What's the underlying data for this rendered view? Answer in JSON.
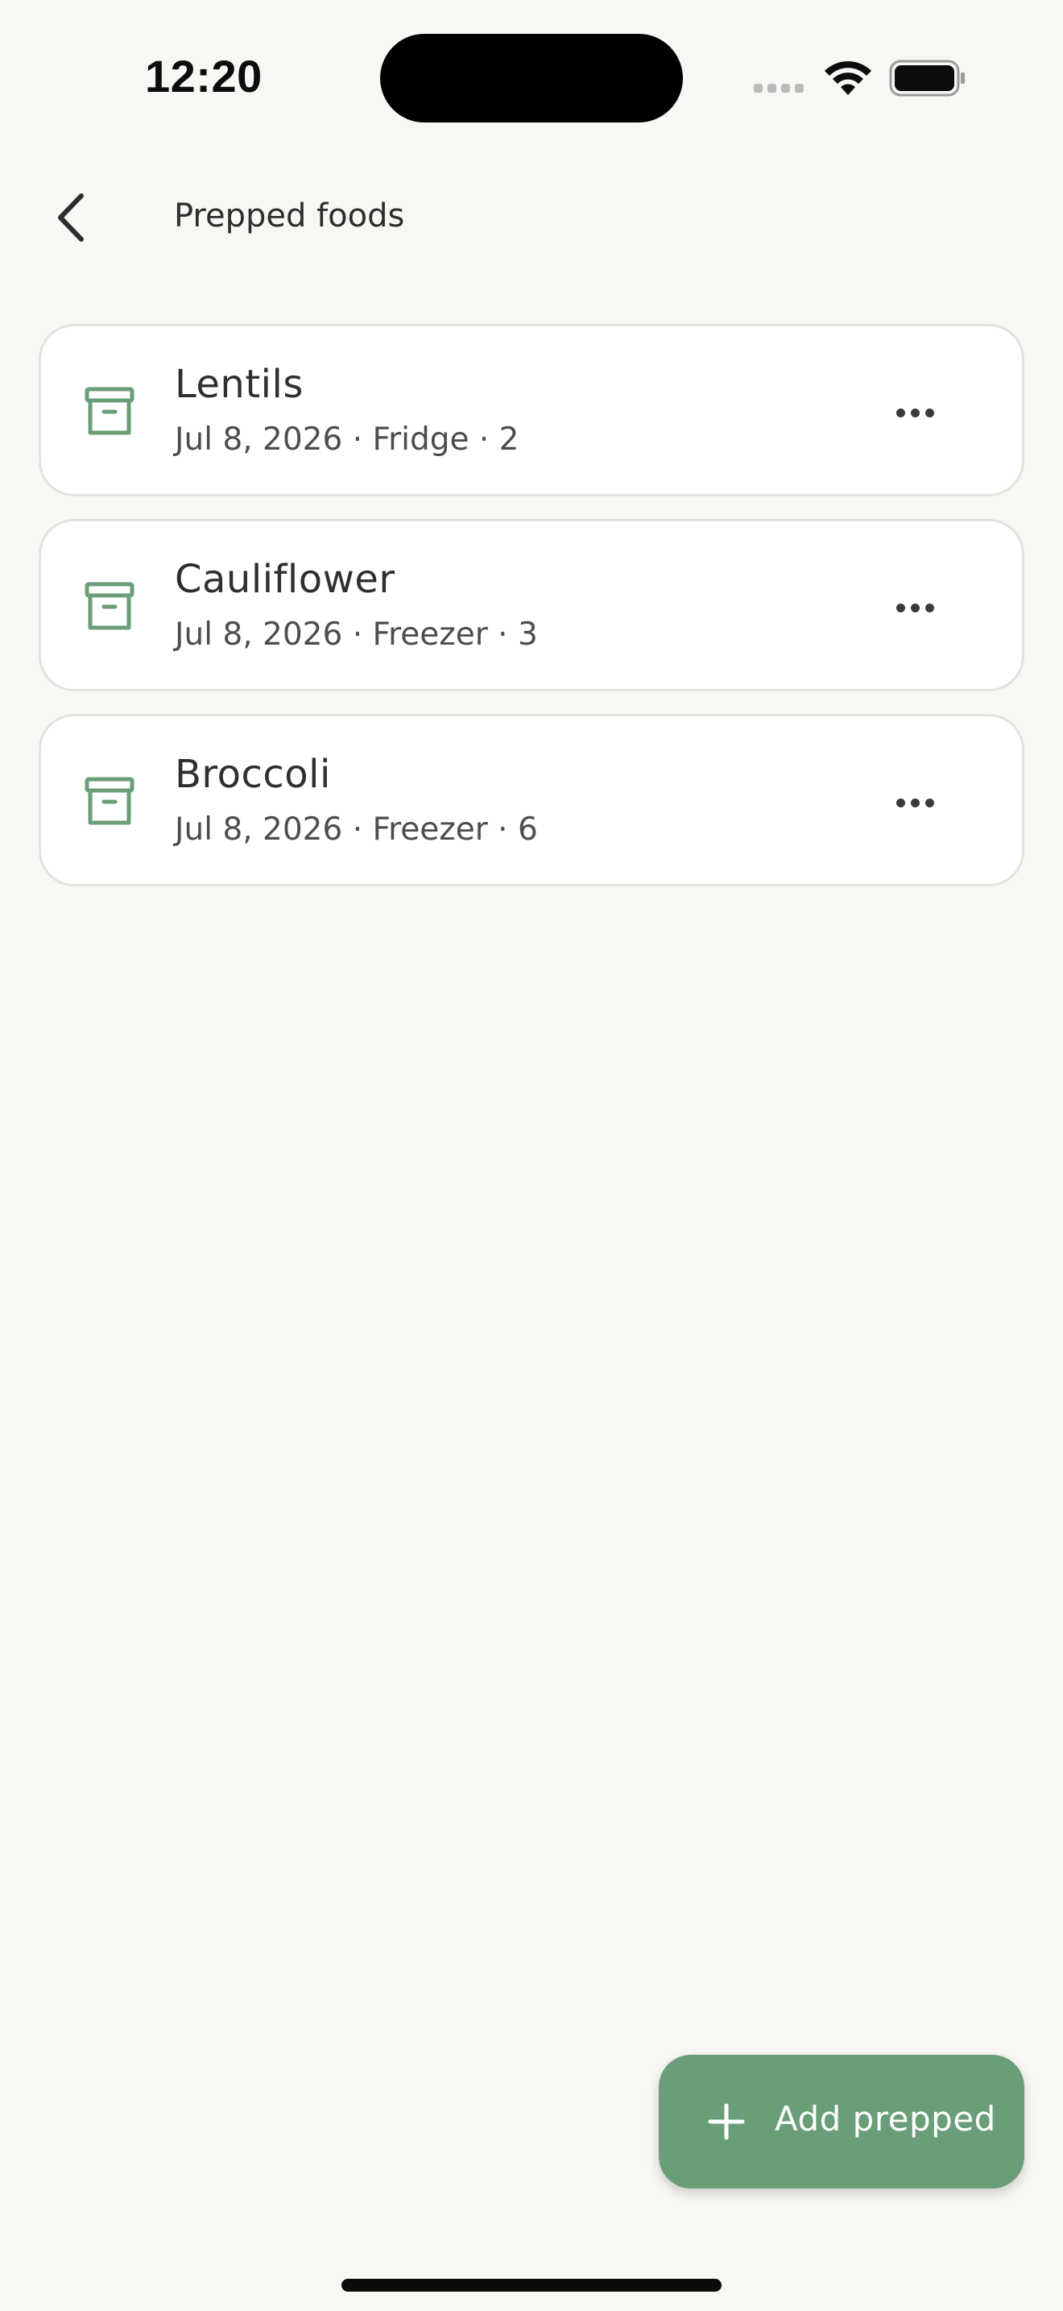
{
  "status_bar": {
    "time": "12:20"
  },
  "header": {
    "back_icon": "chevron-left-icon",
    "title": "Prepped foods"
  },
  "items": [
    {
      "name": "Lentils",
      "meta": "Jul 8, 2026 · Fridge · 2",
      "icon": "archive-box-icon",
      "menu_icon": "more-horizontal-icon"
    },
    {
      "name": "Cauliflower",
      "meta": "Jul 8, 2026 · Freezer · 3",
      "icon": "archive-box-icon",
      "menu_icon": "more-horizontal-icon"
    },
    {
      "name": "Broccoli",
      "meta": "Jul 8, 2026 · Freezer · 6",
      "icon": "archive-box-icon",
      "menu_icon": "more-horizontal-icon"
    }
  ],
  "fab": {
    "icon": "plus-icon",
    "label": "Add prepped"
  },
  "colors": {
    "background": "#f8f7f4",
    "accent": "#6a9e78",
    "card": "#ffffff",
    "card_border": "#e3e2dc"
  }
}
